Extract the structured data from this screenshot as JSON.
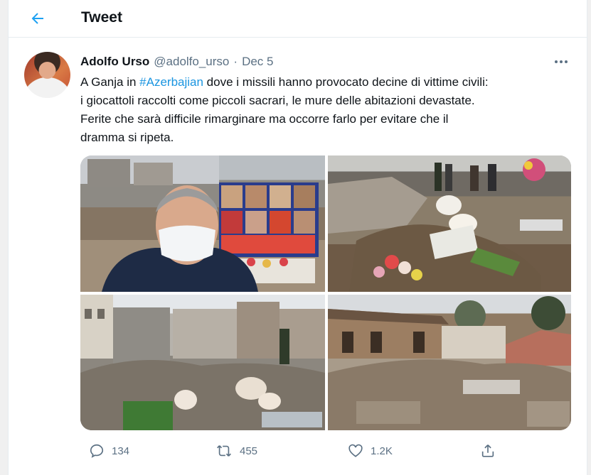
{
  "header": {
    "title": "Tweet",
    "back_icon": "arrow-left-icon",
    "accent": "#1da1f2"
  },
  "tweet": {
    "author_name": "Adolfo Urso",
    "handle": "@adolfo_urso",
    "separator": "·",
    "date": "Dec 5",
    "text": {
      "line1_pre": "A Ganja in ",
      "hashtag": "#Azerbajian",
      "line1_post": " dove i missili hanno provocato decine di vittime civili:",
      "line2": "i giocattoli raccolti come piccoli sacrari, le mure delle abitazioni devastate.",
      "line3": "Ferite che sarà difficile rimarginare ma occorre farlo per evitare che il",
      "line4": "dramma si ripeta."
    },
    "hashtag_color": "#1b95e0",
    "media_count": 4,
    "actions": {
      "replies": "134",
      "retweets": "455",
      "likes": "1.2K"
    }
  }
}
